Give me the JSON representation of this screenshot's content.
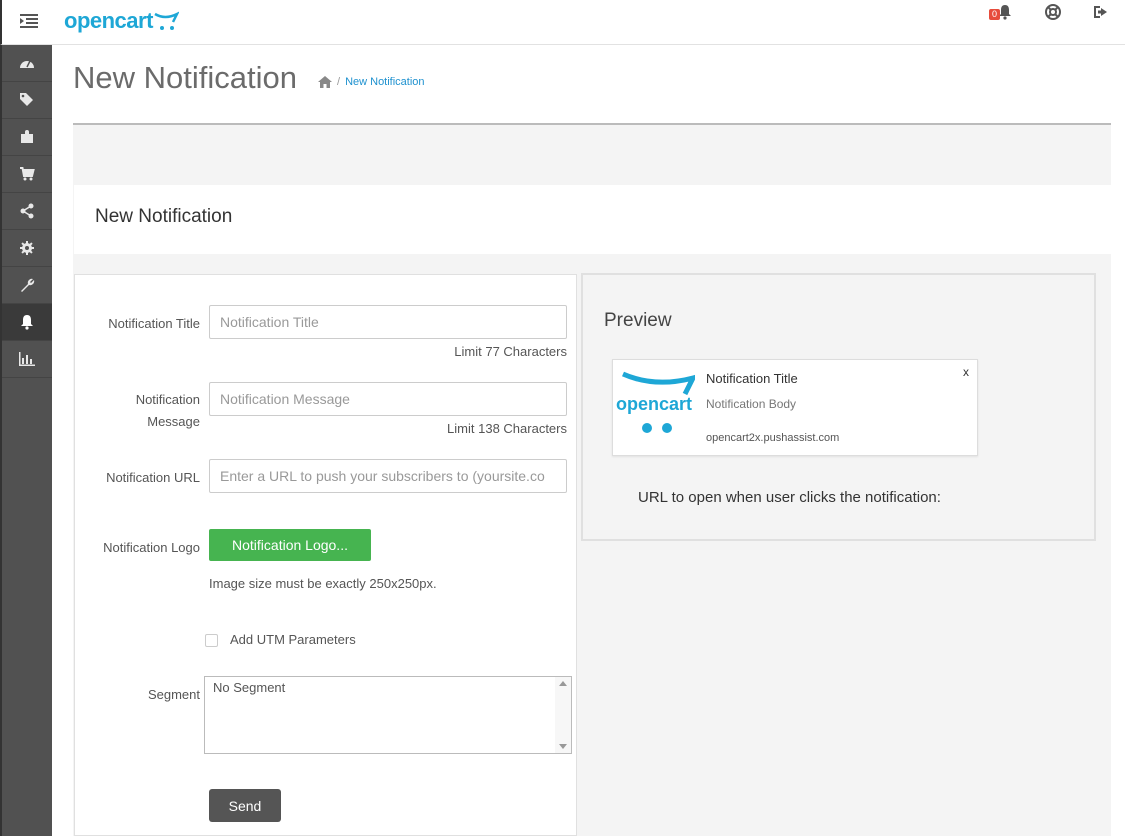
{
  "topbar": {
    "logo_text": "opencart",
    "notification_count": "0",
    "icons": [
      "menu-icon",
      "bell-icon",
      "lifebuoy-icon",
      "logout-icon"
    ]
  },
  "sidebar": {
    "items": [
      {
        "icon": "dashboard-icon"
      },
      {
        "icon": "tags-icon"
      },
      {
        "icon": "puzzle-icon"
      },
      {
        "icon": "cart-icon"
      },
      {
        "icon": "share-icon"
      },
      {
        "icon": "gear-icon"
      },
      {
        "icon": "wrench-icon"
      },
      {
        "icon": "bell-icon",
        "active": true
      },
      {
        "icon": "bar-chart-icon"
      }
    ]
  },
  "page": {
    "title": "New Notification",
    "breadcrumb": [
      "New Notification"
    ]
  },
  "panel": {
    "title": "New Notification"
  },
  "form": {
    "title_label": "Notification Title",
    "title_placeholder": "Notification Title",
    "title_limit": "Limit 77 Characters",
    "message_label_line1": "Notification",
    "message_label_line2": "Message",
    "message_placeholder": "Notification Message",
    "message_limit": "Limit 138 Characters",
    "url_label": "Notification URL",
    "url_placeholder": "Enter a URL to push your subscribers to (yoursite.co",
    "logo_label": "Notification Logo",
    "logo_button": "Notification Logo...",
    "logo_note": "Image size must be exactly 250x250px.",
    "utm_label": "Add UTM Parameters",
    "segment_label": "Segment",
    "segment_value": "No Segment",
    "send_button": "Send"
  },
  "preview": {
    "title": "Preview",
    "notif_title": "Notification Title",
    "notif_body": "Notification Body",
    "notif_url": "opencart2x.pushassist.com",
    "close": "x",
    "caption": "URL to open when user clicks the notification:"
  },
  "colors": {
    "brand": "#1ea7d6",
    "green": "#46b450",
    "sidebar": "#515151",
    "badge": "#e74c3c"
  }
}
